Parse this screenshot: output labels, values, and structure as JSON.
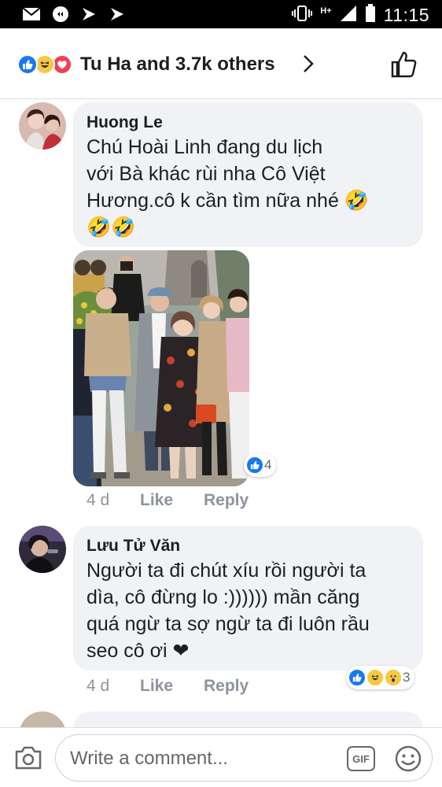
{
  "status_bar": {
    "time": "11:15",
    "network": "H+"
  },
  "header": {
    "reactions": [
      "like-icon",
      "haha-icon",
      "love-icon"
    ],
    "title": "Tu Ha and 3.7k others"
  },
  "comments": [
    {
      "name": "Huong Le",
      "text_lines": [
        "Chú Hoài Linh đang du lịch",
        "với Bà khác rùi nha Cô Việt",
        "Hương.cô k cần tìm nữa nhé 🤣",
        "🤣🤣"
      ],
      "time": "4 d",
      "like_label": "Like",
      "reply_label": "Reply",
      "reaction_count": "4"
    },
    {
      "name": "Lưu Tử Văn",
      "text_lines": [
        "Người ta đi chút xíu rồi người ta",
        "dìa, cô đừng lo :)))))) mần căng",
        "quá ngừ ta sợ ngừ ta đi luôn rầu",
        "seo cô ơi ❤"
      ],
      "time": "4 d",
      "like_label": "Like",
      "reply_label": "Reply",
      "reaction_count": "3"
    }
  ],
  "composer": {
    "placeholder": "Write a comment...",
    "gif_label": "GIF"
  },
  "colors": {
    "accent": "#1877f2",
    "bubble": "#f0f2f5",
    "meta": "#8d949e",
    "love": "#f33e58"
  }
}
